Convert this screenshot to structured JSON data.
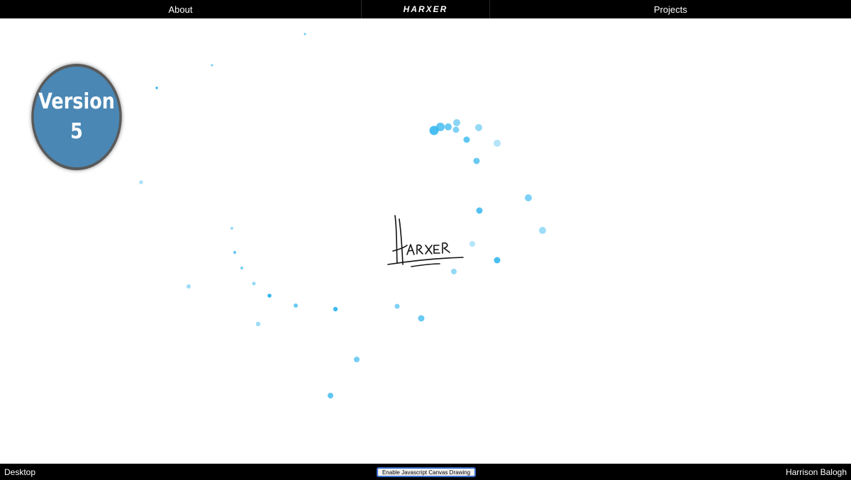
{
  "nav": {
    "about_label": "About",
    "logo_text": "HARXER",
    "projects_label": "Projects"
  },
  "badge": {
    "line1": "Version",
    "line2": "5",
    "color": "#4a87b4"
  },
  "signature": {
    "text": "HARXER"
  },
  "footer": {
    "left_text": "Desktop",
    "button_label": "Enable Javascript Canvas Drawing",
    "right_text": "Harrison Balogh"
  },
  "colors": {
    "dot": "#29b3ee",
    "bar": "#000000"
  }
}
